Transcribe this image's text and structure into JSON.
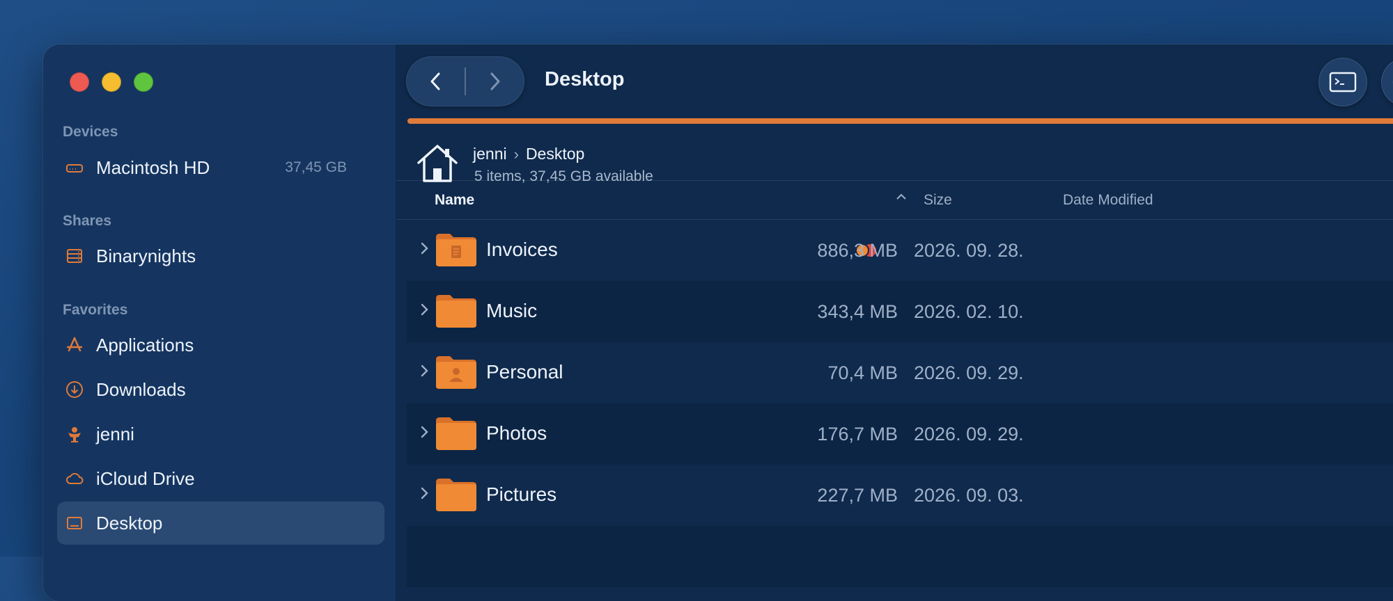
{
  "window": {
    "title": "Desktop"
  },
  "sidebar": {
    "sections": [
      {
        "title": "Devices"
      },
      {
        "title": "Shares"
      },
      {
        "title": "Favorites"
      }
    ],
    "devices": [
      {
        "label": "Macintosh HD",
        "extra": "37,45 GB",
        "icon": "drive-icon"
      }
    ],
    "shares": [
      {
        "label": "Binarynights",
        "icon": "server-icon"
      }
    ],
    "favorites": [
      {
        "label": "Applications",
        "icon": "applications-icon"
      },
      {
        "label": "Downloads",
        "icon": "download-icon"
      },
      {
        "label": "jenni",
        "icon": "user-icon"
      },
      {
        "label": "iCloud Drive",
        "icon": "cloud-icon"
      },
      {
        "label": "Desktop",
        "icon": "desktop-icon",
        "active": true
      }
    ]
  },
  "path": {
    "crumbs": [
      "jenni",
      "Desktop"
    ],
    "info": "5 items, 37,45 GB available"
  },
  "columns": {
    "name": "Name",
    "size": "Size",
    "date": "Date Modified"
  },
  "files": [
    {
      "name": "Invoices",
      "size": "886,3 MB",
      "date": "2026. 09. 28.",
      "folder_badge": "document",
      "tags": [
        "#f08a35",
        "#e8433d"
      ]
    },
    {
      "name": "Music",
      "size": "343,4 MB",
      "date": "2026. 02. 10."
    },
    {
      "name": "Personal",
      "size": "70,4 MB",
      "date": "2026. 09. 29.",
      "folder_badge": "person"
    },
    {
      "name": "Photos",
      "size": "176,7 MB",
      "date": "2026. 09. 29."
    },
    {
      "name": "Pictures",
      "size": "227,7 MB",
      "date": "2026. 09. 03."
    }
  ],
  "colors": {
    "accent": "#e07a3a",
    "folder": "#f08a35",
    "background": "#0f2a4c",
    "sidebar": "#153560"
  }
}
